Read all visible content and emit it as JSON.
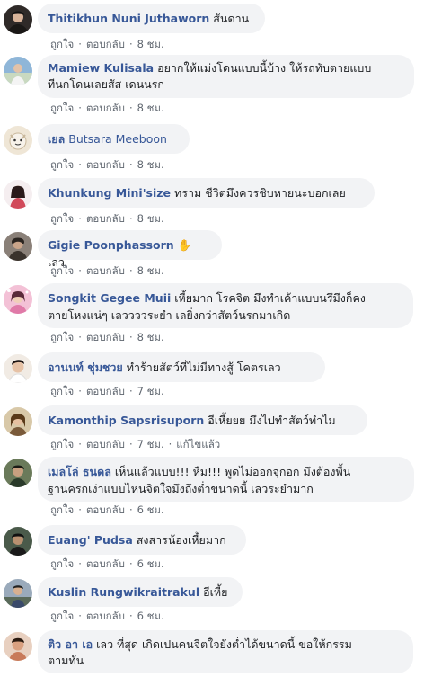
{
  "labels": {
    "like": "ถูกใจ",
    "reply": "ตอบกลับ",
    "separator": "·"
  },
  "comments": [
    {
      "author": "Thitikhun Nuni Juthaworn",
      "text": "สันดาน",
      "time": "8 ชม.",
      "avatar_color": "#2f2a28"
    },
    {
      "author": "Mamiew Kulisala",
      "text": "อยากให้แม่งโดนแบบนี้บ้าง ให้รถทับตายแบบทีนกโดนเลยสัส เดนนรก",
      "text_line1": "อยากให้แม่งโดนแบบนี้บ้าง ให้รถทับตายแบบ",
      "text_line2": "ทีนกโดนเลยสัส เดนนรก",
      "time": "8 ชม.",
      "avatar_color": "#8fb6d8"
    },
    {
      "author": "เยล",
      "text": "Butsara Meeboon",
      "time": "8 ชม.",
      "avatar_color": "#e8dcc8"
    },
    {
      "author": "Khunkung Mini'size",
      "text": "ทราม ชีวิตมึงควรชิบหายนะบอกเลย",
      "time": "8 ชม.",
      "avatar_color": "#d14a5a"
    },
    {
      "author": "Gigie Poonphassorn",
      "text": "เลว",
      "emoji": "✋",
      "time": "8 ชม.",
      "avatar_color": "#5a5048"
    },
    {
      "author": "Songkit Gegee Muii",
      "text": "เหี้ยมาก โรคจิต มึงทำเค้าแบบนรึมึงก็คงตายโหงแน่ๆ เลววววระยำ เลยิ่งกว่าสัตว์นรกมาเกิด",
      "text_line1": "เหี้ยมาก โรคจิต มึงทำเค้าแบบนรึมึงก็คง",
      "text_line2": "ตายโหงแน่ๆ เลววววระยำ เลยิ่งกว่าสัตว์นรกมาเกิด",
      "time": "8 ชม.",
      "avatar_color": "#e07aa8"
    },
    {
      "author": "อานนท์ ชุ่มชวย",
      "text": "ทำร้ายสัตว์ที่ไม่มีทางสู้ โคตรเลว",
      "time": "7 ชม.",
      "avatar_color": "#d9b8a0"
    },
    {
      "author": "Kamonthip Sapsrisuporn",
      "text": "อีเหี้ยยย มึงไปทำสัตว์ทำไม",
      "time": "7 ชม.",
      "edited": "แก้ไขแล้ว",
      "avatar_color": "#7a5a3a"
    },
    {
      "author": "เมลโล่ ธนดล",
      "text": "เห็นแล้วแบบ!!! หืม!!! พูดไม่ออกจุกอก มึงต้องพื้นฐานครกเง่าแบบไหนจิตใจมึงถึงต่ำขนาดนี้ เลวระยำมาก",
      "text_line1": "เห็นแล้วแบบ!!! หืม!!! พูดไม่ออกจุกอก มึงต้องพื้น",
      "text_line2": "ฐานครกเง่าแบบไหนจิตใจมึงถึงต่ำขนาดนี้ เลวระยำมาก",
      "time": "6 ชม.",
      "avatar_color": "#4a5a3a"
    },
    {
      "author": "Euang' Pudsa",
      "text": "สงสารน้องเหี้ยมาก",
      "time": "6 ชม.",
      "avatar_color": "#3a4a3a"
    },
    {
      "author": "Kuslin Rungwikraitrakul",
      "text": "อีเหี้ย",
      "time": "6 ชม.",
      "avatar_color": "#6a7a8a"
    },
    {
      "author": "ติว อา เอ",
      "text": "เลว ที่สุด เกิดเปนคนจิตใจยังต่ำได้ขนาดนี้ ขอให้กรรมตามทัน",
      "text_line1": "เลว ที่สุด เกิดเปนคนจิตใจยังต่ำได้ขนาดนี้ ขอให้กรรม",
      "text_line2": "ตามทัน",
      "time": "6 ชม.",
      "avatar_color": "#c87a5a"
    }
  ]
}
